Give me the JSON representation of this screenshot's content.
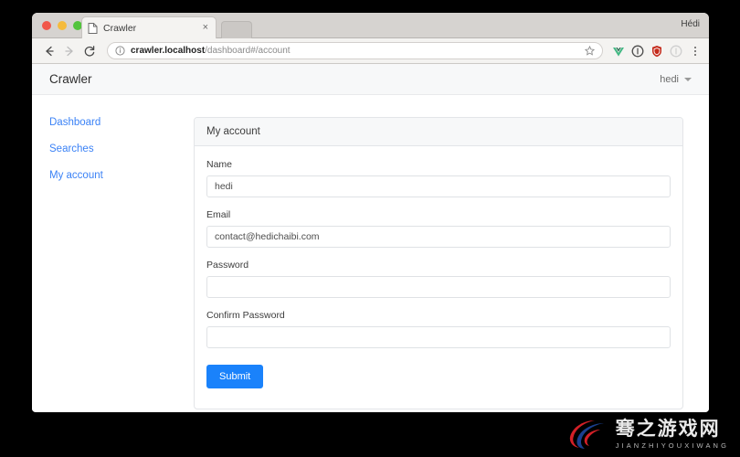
{
  "browser": {
    "profile_name": "Hédi",
    "tab": {
      "title": "Crawler",
      "close_label": "×",
      "favicon_name": "page-icon"
    },
    "toolbar": {
      "back_label": "←",
      "forward_label": "→",
      "reload_label": "⟳",
      "url_host": "crawler.localhost",
      "url_path": "/dashboard#/account",
      "site_info_label": "ⓘ",
      "bookmark_label": "☆",
      "extensions": [
        {
          "name": "vue-devtools-icon",
          "color": "#42b883"
        },
        {
          "name": "adblock-icon",
          "color": "#4a4a4a"
        },
        {
          "name": "shield-extension-icon",
          "color": "#c42b1c"
        },
        {
          "name": "generic-extension-icon",
          "color": "#d0d0d0"
        }
      ],
      "menu_label": "chrome-menu-icon"
    }
  },
  "app": {
    "brand": "Crawler",
    "user_menu": {
      "username": "hedi"
    },
    "sidebar": {
      "items": [
        {
          "label": "Dashboard",
          "name": "dashboard"
        },
        {
          "label": "Searches",
          "name": "searches"
        },
        {
          "label": "My account",
          "name": "my-account"
        }
      ]
    },
    "card": {
      "title": "My account",
      "fields": [
        {
          "label": "Name",
          "value": "hedi",
          "placeholder": "",
          "type": "text",
          "name": "name"
        },
        {
          "label": "Email",
          "value": "contact@hedichaibi.com",
          "placeholder": "",
          "type": "text",
          "name": "email"
        },
        {
          "label": "Password",
          "value": "",
          "placeholder": "",
          "type": "password",
          "name": "password"
        },
        {
          "label": "Confirm Password",
          "value": "",
          "placeholder": "",
          "type": "password",
          "name": "confirm-password"
        }
      ],
      "submit_label": "Submit"
    }
  },
  "theme": {
    "link_blue": "#3b82f6",
    "button_blue": "#1a82fb",
    "header_grey": "#f7f8f9",
    "border_grey": "#e3e5e8"
  },
  "watermark": {
    "cn_text": "骞之游戏网",
    "en_text": "JIANZHIYOUXIWANG"
  }
}
